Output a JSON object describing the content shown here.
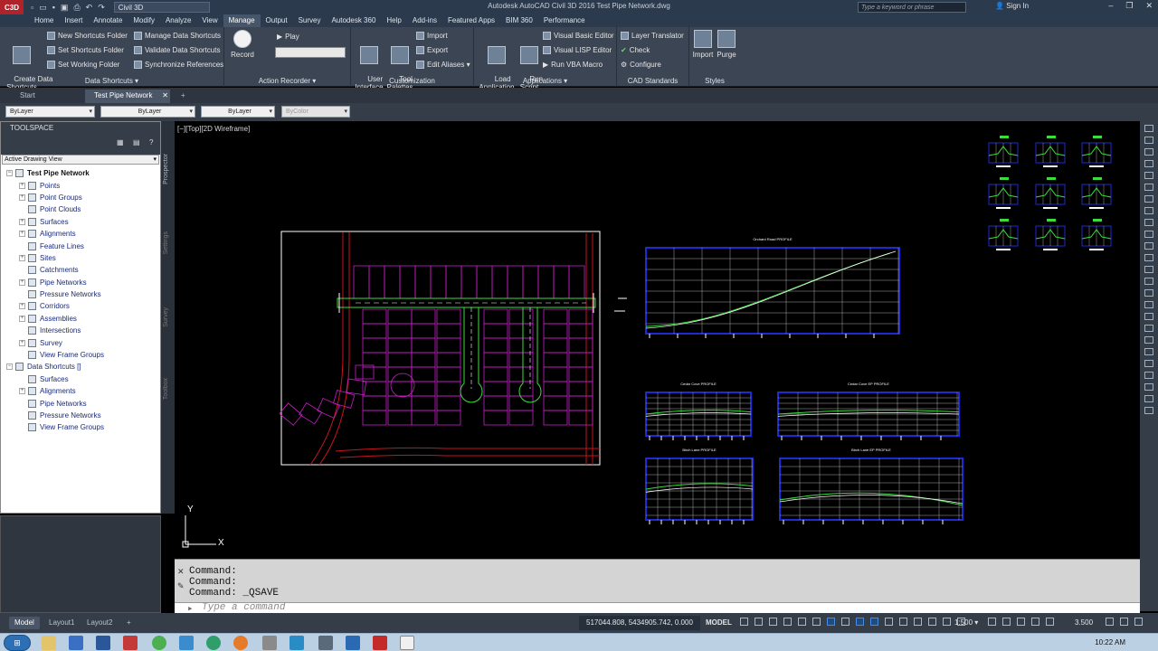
{
  "titlebar": {
    "app_button": "C3D",
    "workspace": "Civil 3D",
    "title": "Autodesk AutoCAD Civil 3D 2016   Test Pipe Network.dwg",
    "search_placeholder": "Type a keyword or phrase",
    "sign_in": "Sign In"
  },
  "menu_tabs": [
    "Home",
    "Insert",
    "Annotate",
    "Modify",
    "Analyze",
    "View",
    "Manage",
    "Output",
    "Survey",
    "Autodesk 360",
    "Help",
    "Add-ins",
    "Featured Apps",
    "BIM 360",
    "Performance"
  ],
  "active_menu_tab": "Manage",
  "ribbon": {
    "data_shortcuts": {
      "title": "Data Shortcuts ▾",
      "big": "Create Data\nShortcuts",
      "items": [
        "New Shortcuts Folder",
        "Set Shortcuts Folder",
        "Set Working Folder",
        "Manage Data Shortcuts",
        "Validate Data Shortcuts",
        "Synchronize References"
      ]
    },
    "action_recorder": {
      "title": "Action Recorder ▾",
      "record": "Record",
      "play": "Play"
    },
    "customization": {
      "title": "Customization",
      "user_interface": "User\nInterface",
      "tool_palettes": "Tool\nPalettes",
      "import": "Import",
      "export": "Export",
      "edit_aliases": "Edit Aliases ▾"
    },
    "applications": {
      "title": "Applications ▾",
      "load_application": "Load\nApplication",
      "run_script": "Run\nScript",
      "vb_editor": "Visual Basic Editor",
      "lisp_editor": "Visual LISP Editor",
      "run_vba": "Run VBA Macro"
    },
    "cad_standards": {
      "title": "CAD Standards",
      "layer_translator": "Layer Translator",
      "check": "Check",
      "configure": "Configure"
    },
    "styles": {
      "title": "Styles",
      "import": "Import",
      "purge": "Purge"
    }
  },
  "file_tabs": [
    "Start",
    "Test Pipe Network"
  ],
  "properties": {
    "color": "ByLayer",
    "linetype": "ByLayer",
    "lineweight": "ByLayer",
    "plotstyle": "ByColor"
  },
  "toolspace": {
    "title": "TOOLSPACE",
    "view_selector": "Active Drawing View",
    "tree": [
      {
        "label": "Test Pipe Network",
        "level": 0,
        "root": true,
        "exp": "−"
      },
      {
        "label": "Points",
        "level": 1,
        "exp": "+"
      },
      {
        "label": "Point Groups",
        "level": 1,
        "exp": "+"
      },
      {
        "label": "Point Clouds",
        "level": 1,
        "exp": ""
      },
      {
        "label": "Surfaces",
        "level": 1,
        "exp": "+"
      },
      {
        "label": "Alignments",
        "level": 1,
        "exp": "+"
      },
      {
        "label": "Feature Lines",
        "level": 1,
        "exp": ""
      },
      {
        "label": "Sites",
        "level": 1,
        "exp": "+"
      },
      {
        "label": "Catchments",
        "level": 1,
        "exp": ""
      },
      {
        "label": "Pipe Networks",
        "level": 1,
        "exp": "+"
      },
      {
        "label": "Pressure Networks",
        "level": 1,
        "exp": ""
      },
      {
        "label": "Corridors",
        "level": 1,
        "exp": "+"
      },
      {
        "label": "Assemblies",
        "level": 1,
        "exp": "+"
      },
      {
        "label": "Intersections",
        "level": 1,
        "exp": ""
      },
      {
        "label": "Survey",
        "level": 1,
        "exp": "+"
      },
      {
        "label": "View Frame Groups",
        "level": 1,
        "exp": ""
      },
      {
        "label": "Data Shortcuts []",
        "level": 0,
        "root": false,
        "exp": "−"
      },
      {
        "label": "Surfaces",
        "level": 1,
        "exp": ""
      },
      {
        "label": "Alignments",
        "level": 1,
        "exp": "+"
      },
      {
        "label": "Pipe Networks",
        "level": 1,
        "exp": ""
      },
      {
        "label": "Pressure Networks",
        "level": 1,
        "exp": ""
      },
      {
        "label": "View Frame Groups",
        "level": 1,
        "exp": ""
      }
    ],
    "side_tabs": [
      "Prospector",
      "Settings",
      "Survey",
      "Toolbox"
    ]
  },
  "viewport": {
    "label": "[−][Top][2D Wireframe]",
    "profiles": [
      "Orchard Road PROFILE",
      "Cedar Cove PROFILE",
      "Cedar Cove EP PROFILE",
      "Birch Lane PROFILE",
      "Birch Lane EP PROFILE"
    ],
    "ucs_y": "Y",
    "ucs_x": "X"
  },
  "command": {
    "history": [
      "Command:",
      "Command:",
      "Command:  _QSAVE"
    ],
    "placeholder": "Type a command"
  },
  "statusbar": {
    "layouts": [
      "Model",
      "Layout1",
      "Layout2"
    ],
    "coords": "517044.808, 5434905.742, 0.000",
    "model": "MODEL",
    "scale": "1:500 ▾",
    "lineweight": "3.500"
  },
  "taskbar": {
    "time": "10:22 AM"
  },
  "colors": {
    "magenta": "#c81ec8",
    "red": "#c8141e",
    "green": "#3cdc3c",
    "blue": "#1e2ad2",
    "white": "#ffffff"
  }
}
